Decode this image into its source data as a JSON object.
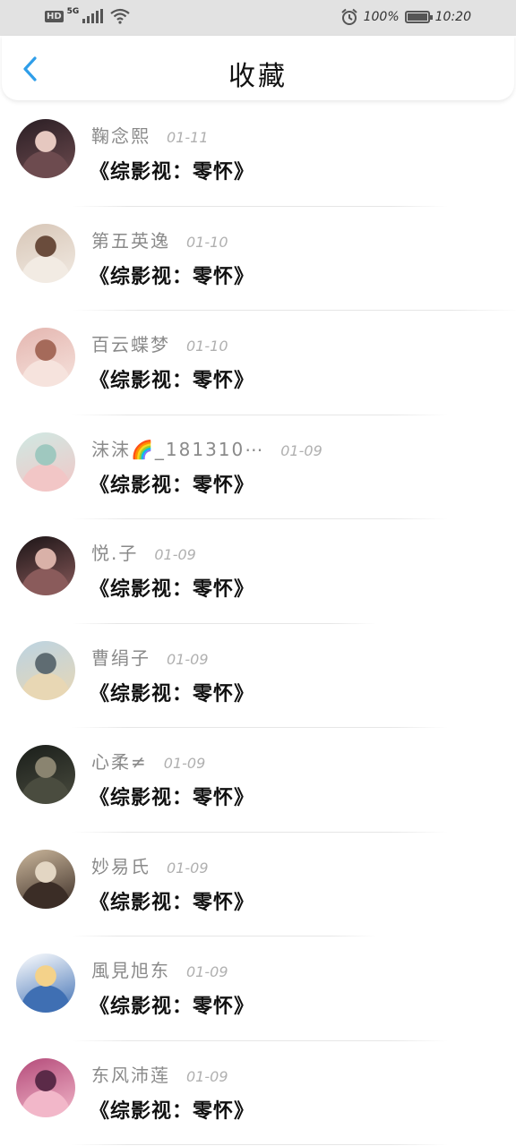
{
  "status_bar": {
    "hd": "HD",
    "network": "5G",
    "battery_text": "100%",
    "time": "10:20"
  },
  "header": {
    "title": "收藏",
    "accent_color": "#2f9ee9"
  },
  "items": [
    {
      "name": "鞠念熙",
      "date": "01-11",
      "title": "《综影视：零怀》",
      "avatar_colors": [
        "#2a1e24",
        "#6d4b4f",
        "#e6c8c0"
      ]
    },
    {
      "name": "第五英逸",
      "date": "01-10",
      "title": "《综影视：零怀》",
      "avatar_colors": [
        "#d7c6b7",
        "#f2ebe3",
        "#6a4c3c"
      ]
    },
    {
      "name": "百云蝶梦",
      "date": "01-10",
      "title": "《综影视：零怀》",
      "avatar_colors": [
        "#e4b6b0",
        "#f6e3dd",
        "#a56a5a"
      ]
    },
    {
      "name": "沫沫🌈_181310⋯",
      "date": "01-09",
      "title": "《综影视：零怀》",
      "avatar_colors": [
        "#cfe9e3",
        "#f2c6c6",
        "#9fc8bf"
      ]
    },
    {
      "name": "悦.子",
      "date": "01-09",
      "title": "《综影视：零怀》",
      "avatar_colors": [
        "#1b1416",
        "#8a5b5b",
        "#d9b1a8"
      ]
    },
    {
      "name": "曹绢子",
      "date": "01-09",
      "title": "《综影视：零怀》",
      "avatar_colors": [
        "#bcd3e2",
        "#e8d7b4",
        "#5f6c72"
      ]
    },
    {
      "name": "心柔≠",
      "date": "01-09",
      "title": "《综影视：零怀》",
      "avatar_colors": [
        "#1a1e1a",
        "#4a4c3f",
        "#8a8470"
      ]
    },
    {
      "name": "妙易氏",
      "date": "01-09",
      "title": "《综影视：零怀》",
      "avatar_colors": [
        "#cbb79c",
        "#3b2d26",
        "#e3d6c3"
      ]
    },
    {
      "name": "風見旭东",
      "date": "01-09",
      "title": "《综影视：零怀》",
      "avatar_colors": [
        "#ffffff",
        "#3f6fb3",
        "#f4d28a"
      ]
    },
    {
      "name": "东风沛莲",
      "date": "01-09",
      "title": "《综影视：零怀》",
      "avatar_colors": [
        "#b44b7a",
        "#f2b7c9",
        "#5b2a48"
      ]
    }
  ]
}
